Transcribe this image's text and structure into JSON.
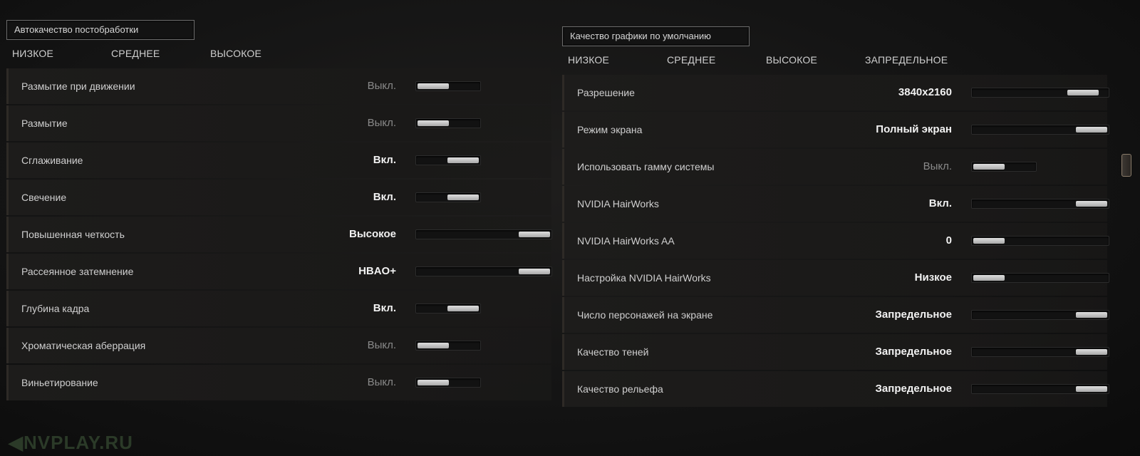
{
  "left_panel": {
    "preset_title": "Автокачество постобработки",
    "presets": [
      "НИЗКОЕ",
      "СРЕДНЕЕ",
      "ВЫСОКОЕ"
    ],
    "rows": [
      {
        "label": "Размытие при движении",
        "value": "Выкл.",
        "state": "off",
        "slider": "toggle",
        "level": 0
      },
      {
        "label": "Размытие",
        "value": "Выкл.",
        "state": "off",
        "slider": "toggle",
        "level": 0
      },
      {
        "label": "Сглаживание",
        "value": "Вкл.",
        "state": "on",
        "slider": "toggle",
        "level": 1
      },
      {
        "label": "Свечение",
        "value": "Вкл.",
        "state": "on",
        "slider": "toggle",
        "level": 1
      },
      {
        "label": "Повышенная четкость",
        "value": "Высокое",
        "state": "on",
        "slider": "range",
        "level": 1
      },
      {
        "label": "Рассеянное затемнение",
        "value": "HBAO+",
        "state": "on",
        "slider": "range",
        "level": 1
      },
      {
        "label": "Глубина кадра",
        "value": "Вкл.",
        "state": "on",
        "slider": "toggle",
        "level": 1
      },
      {
        "label": "Хроматическая аберрация",
        "value": "Выкл.",
        "state": "off",
        "slider": "toggle",
        "level": 0
      },
      {
        "label": "Виньетирование",
        "value": "Выкл.",
        "state": "off",
        "slider": "toggle",
        "level": 0
      }
    ]
  },
  "right_panel": {
    "preset_title": "Качество графики по умолчанию",
    "presets": [
      "НИЗКОЕ",
      "СРЕДНЕЕ",
      "ВЫСОКОЕ",
      "ЗАПРЕДЕЛЬНОЕ"
    ],
    "rows": [
      {
        "label": "Разрешение",
        "value": "3840x2160",
        "state": "on",
        "slider": "range",
        "level": 0.92
      },
      {
        "label": "Режим экрана",
        "value": "Полный экран",
        "state": "on",
        "slider": "range",
        "level": 1
      },
      {
        "label": "Использовать гамму системы",
        "value": "Выкл.",
        "state": "off",
        "slider": "toggle",
        "level": 0
      },
      {
        "label": "NVIDIA HairWorks",
        "value": "Вкл.",
        "state": "on",
        "slider": "range",
        "level": 1
      },
      {
        "label": "NVIDIA HairWorks AA",
        "value": "0",
        "state": "on",
        "slider": "range",
        "level": 0
      },
      {
        "label": "Настройка NVIDIA HairWorks",
        "value": "Низкое",
        "state": "on",
        "slider": "range",
        "level": 0
      },
      {
        "label": "Число персонажей на экране",
        "value": "Запредельное",
        "state": "on",
        "slider": "range",
        "level": 1
      },
      {
        "label": "Качество теней",
        "value": "Запредельное",
        "state": "on",
        "slider": "range",
        "level": 1
      },
      {
        "label": "Качество рельефа",
        "value": "Запредельное",
        "state": "on",
        "slider": "range",
        "level": 1
      }
    ]
  },
  "watermark": "◀NVPLAY.RU",
  "colors": {
    "on_value": "#f2f2f2",
    "off_value": "#8a8a8a",
    "knob": "#c8c8c8",
    "background": "#141414"
  }
}
